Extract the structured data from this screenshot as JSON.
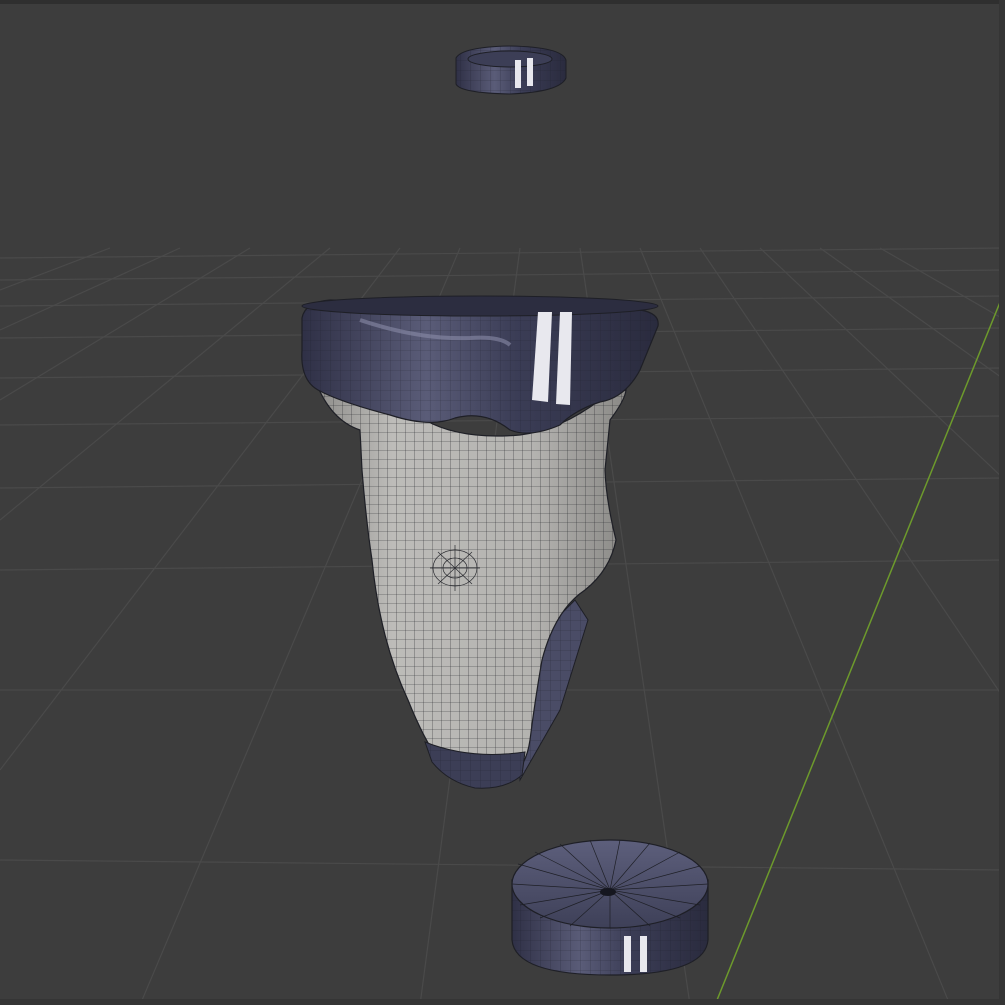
{
  "app": {
    "name": "3D Viewport"
  },
  "viewport": {
    "background": "#3d3d3d",
    "grid_color": "#4a4a4a",
    "y_axis_color": "#6d9a2c",
    "objects": [
      {
        "name": "small-ring-object",
        "material": "dark-metal"
      },
      {
        "name": "garment-mesh-object",
        "material": "cloth-white"
      },
      {
        "name": "cylinder-base-object",
        "material": "dark-metal"
      }
    ]
  },
  "colors": {
    "dark_metal": "#4a4c66",
    "dark_metal_shade": "#2f3046",
    "cloth": "#b6b5b2",
    "cloth_shade": "#8d8c89",
    "wire": "#1e1f26"
  }
}
